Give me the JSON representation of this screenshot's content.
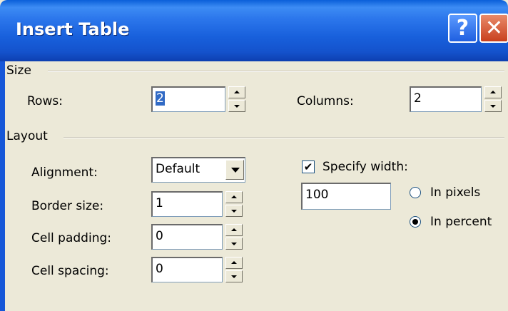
{
  "dialog": {
    "title": "Insert Table",
    "help_label": "?",
    "close_label": "✕"
  },
  "size_section": {
    "label": "Size",
    "rows_label": "Rows:",
    "rows_value": "2",
    "columns_label": "Columns:",
    "columns_value": "2"
  },
  "layout_section": {
    "label": "Layout",
    "alignment_label": "Alignment:",
    "alignment_value": "Default",
    "border_size_label": "Border size:",
    "border_size_value": "1",
    "cell_padding_label": "Cell padding:",
    "cell_padding_value": "0",
    "cell_spacing_label": "Cell spacing:",
    "cell_spacing_value": "0",
    "specify_width_label": "Specify width:",
    "specify_width_checked": true,
    "width_value": "100",
    "in_pixels_label": "In pixels",
    "in_percent_label": "In percent",
    "width_unit_selected": "In percent"
  },
  "icons": {
    "check_mark": "✔"
  },
  "colors": {
    "title_bar": "#1860DC",
    "dialog_face": "#ECE9D8",
    "selection": "#316AC5",
    "close_button": "#C8401E"
  }
}
